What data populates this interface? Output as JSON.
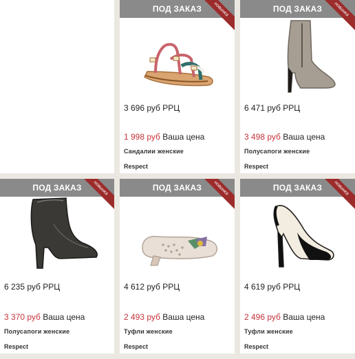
{
  "products": [
    {
      "banner": "ПОД ЗАКАЗ",
      "corner": "новинка",
      "rrc_price": "3 696 руб РРЦ",
      "our_price": "1 998 руб",
      "our_label": "Ваша цена",
      "title": "Сандалии женские",
      "brand": "Respect",
      "icon": "sandal-icon"
    },
    {
      "banner": "ПОД ЗАКАЗ",
      "corner": "новинка",
      "rrc_price": "6 471 руб РРЦ",
      "our_price": "3 498 руб",
      "our_label": "Ваша цена",
      "title": "Полусапоги женские",
      "brand": "Respect",
      "icon": "ankle-boot-icon"
    },
    {
      "banner": "ПОД ЗАКАЗ",
      "corner": "новинка",
      "rrc_price": "6 235 руб РРЦ",
      "our_price": "3 370 руб",
      "our_label": "Ваша цена",
      "title": "Полусапоги женские",
      "brand": "Respect",
      "icon": "black-bootie-icon"
    },
    {
      "banner": "ПОД ЗАКАЗ",
      "corner": "новинка",
      "rrc_price": "4 612 руб РРЦ",
      "our_price": "2 493 руб",
      "our_label": "Ваша цена",
      "title": "Туфли женские",
      "brand": "Respect",
      "icon": "flat-shoe-icon"
    },
    {
      "banner": "ПОД ЗАКАЗ",
      "corner": "новинка",
      "rrc_price": "4 619 руб РРЦ",
      "our_price": "2 496 руб",
      "our_label": "Ваша цена",
      "title": "Туфли женские",
      "brand": "Respect",
      "icon": "peep-toe-heel-icon"
    }
  ],
  "colors": {
    "banner_bg": "#8a8a8a",
    "corner_ribbon": "#9c2b2b",
    "price_red": "#c6323a",
    "page_bg": "#ebe8e2"
  }
}
